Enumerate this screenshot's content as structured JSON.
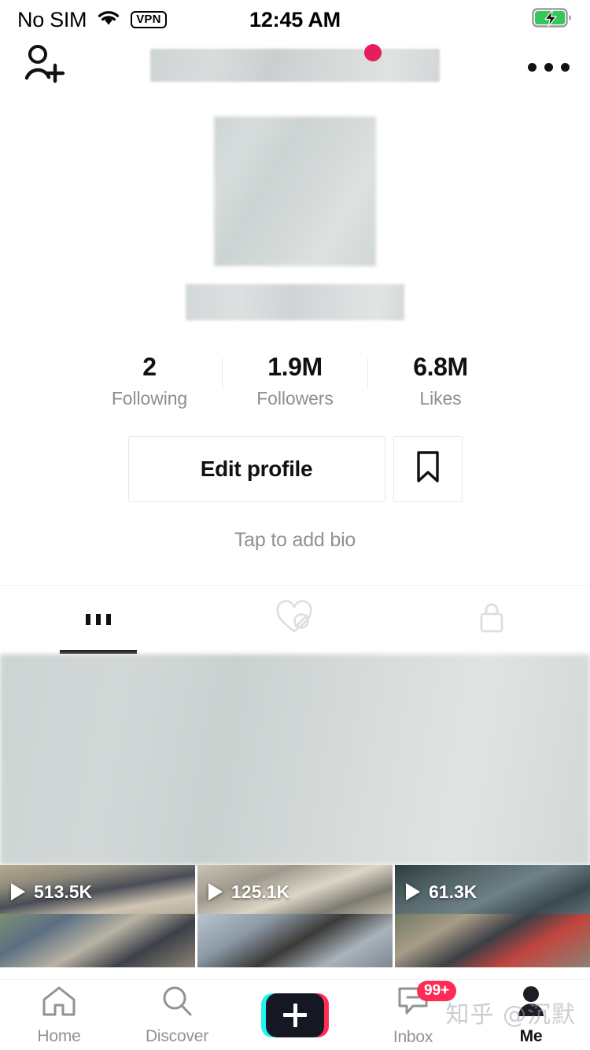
{
  "status_bar": {
    "carrier": "No SIM",
    "vpn_label": "VPN",
    "time": "12:45 AM",
    "wifi_icon": "wifi-icon",
    "battery_icon": "battery-charging-icon"
  },
  "header": {
    "add_friend_icon": "add-person-icon",
    "more_icon": "three-dots-icon",
    "username_hidden": "",
    "notification_dot": true
  },
  "profile": {
    "avatar_hidden": "",
    "username_hidden": "",
    "bio_placeholder": "Tap to add bio",
    "stats": [
      {
        "value": "2",
        "label": "Following"
      },
      {
        "value": "1.9M",
        "label": "Followers"
      },
      {
        "value": "6.8M",
        "label": "Likes"
      }
    ],
    "edit_profile_label": "Edit profile",
    "bookmark_icon": "bookmark-icon"
  },
  "tabs": [
    {
      "icon": "grid-icon",
      "active": true
    },
    {
      "icon": "heart-slash-icon",
      "active": false
    },
    {
      "icon": "lock-icon",
      "active": false
    }
  ],
  "videos": {
    "row1": [
      {
        "views": "513.5K",
        "play_icon": "play-icon"
      },
      {
        "views": "125.1K",
        "play_icon": "play-icon"
      },
      {
        "views": "61.3K",
        "play_icon": "play-icon"
      }
    ],
    "row2": [
      {
        "views": "",
        "play_icon": "play-icon"
      },
      {
        "views": "",
        "play_icon": "play-icon"
      },
      {
        "views": "",
        "play_icon": "play-icon"
      }
    ]
  },
  "bottom_nav": {
    "items": [
      {
        "label": "Home",
        "icon": "home-icon",
        "active": false
      },
      {
        "label": "Discover",
        "icon": "search-icon",
        "active": false
      },
      {
        "label": "",
        "icon": "create-plus-icon",
        "active": false
      },
      {
        "label": "Inbox",
        "icon": "inbox-icon",
        "active": false,
        "badge": "99+"
      },
      {
        "label": "Me",
        "icon": "person-icon",
        "active": true
      }
    ]
  },
  "watermark": {
    "text": "知乎 @沉默"
  },
  "colors": {
    "accent_pink": "#fe2c55",
    "accent_cyan": "#25f4ee",
    "text_primary": "#111111",
    "text_muted": "#8e9397",
    "battery_green": "#34c759"
  }
}
